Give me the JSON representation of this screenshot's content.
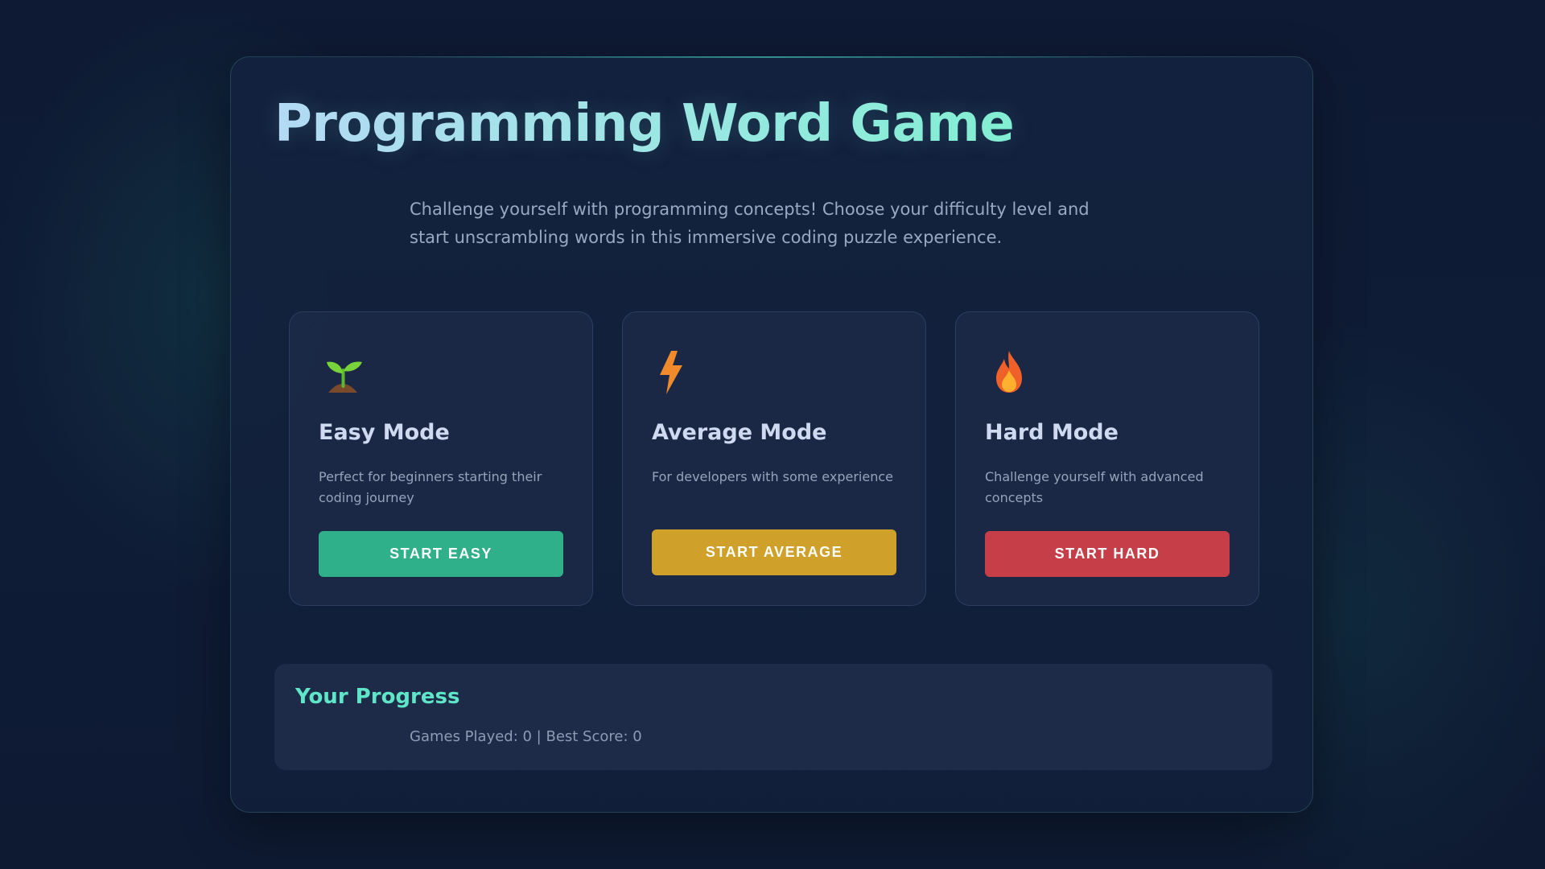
{
  "header": {
    "title": "Programming Word Game",
    "subtitle": "Challenge yourself with programming concepts! Choose your difficulty level and start unscrambling words in this immersive coding puzzle experience."
  },
  "modes": [
    {
      "icon": "seedling-icon",
      "title": "Easy Mode",
      "description": "Perfect for beginners starting their coding journey",
      "button_label": "START EASY",
      "button_color": "#2fb08a"
    },
    {
      "icon": "lightning-bolt-icon",
      "title": "Average Mode",
      "description": "For developers with some experience",
      "button_label": "START AVERAGE",
      "button_color": "#cfa02a"
    },
    {
      "icon": "fire-icon",
      "title": "Hard Mode",
      "description": "Challenge yourself with advanced concepts",
      "button_label": "START HARD",
      "button_color": "#c63f48"
    }
  ],
  "progress": {
    "title": "Your Progress",
    "stats": "Games Played: 0 | Best Score: 0"
  },
  "colors": {
    "background": "#0e1a33",
    "accent": "#5fe6c8",
    "card_background": "#1c2a48"
  }
}
